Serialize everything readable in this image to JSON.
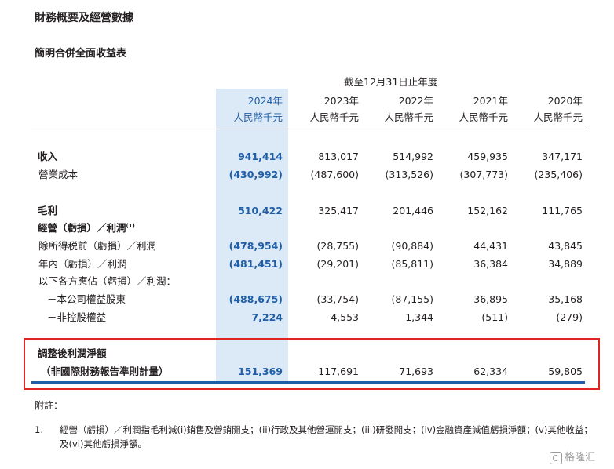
{
  "document": {
    "title": "財務概要及經營數據",
    "subtitle": "簡明合併全面收益表",
    "period_header": "截至12月31日止年度",
    "columns": [
      {
        "year": "2024年",
        "unit": "人民幣千元",
        "highlight": true
      },
      {
        "year": "2023年",
        "unit": "人民幣千元",
        "highlight": false
      },
      {
        "year": "2022年",
        "unit": "人民幣千元",
        "highlight": false
      },
      {
        "year": "2021年",
        "unit": "人民幣千元",
        "highlight": false
      },
      {
        "year": "2020年",
        "unit": "人民幣千元",
        "highlight": false
      }
    ],
    "rows": [
      {
        "label": "收入",
        "values": [
          "941,414",
          "813,017",
          "514,992",
          "459,935",
          "347,171"
        ]
      },
      {
        "label": "營業成本",
        "values": [
          "(430,992)",
          "(487,600)",
          "(313,526)",
          "(307,773)",
          "(235,406)"
        ]
      },
      {
        "label": "毛利",
        "values": [
          "510,422",
          "325,417",
          "201,446",
          "152,162",
          "111,765"
        ]
      },
      {
        "label": "經營（虧損）／利潤",
        "footnote": "(1)",
        "values": []
      },
      {
        "label": "除所得税前（虧損）／利潤",
        "values": [
          "(478,954)",
          "(28,755)",
          "(90,884)",
          "44,431",
          "43,845"
        ]
      },
      {
        "label": "年內（虧損）／利潤",
        "values": [
          "(481,451)",
          "(29,201)",
          "(85,811)",
          "36,384",
          "34,889"
        ]
      },
      {
        "label": "以下各方應佔（虧損）／利潤：",
        "values": []
      },
      {
        "label": "－本公司權益股東",
        "values": [
          "(488,675)",
          "(33,754)",
          "(87,155)",
          "36,895",
          "35,168"
        ]
      },
      {
        "label": "－非控股權益",
        "values": [
          "7,224",
          "4,553",
          "1,344",
          "(511)",
          "(279)"
        ]
      },
      {
        "label": "調整後利潤淨額",
        "values": []
      },
      {
        "label": "（非國際財務報告準則計量）",
        "values": [
          "151,369",
          "117,691",
          "71,693",
          "62,334",
          "59,805"
        ]
      }
    ],
    "notes_header": "附註：",
    "notes": [
      {
        "number": "1.",
        "text": "經營（虧損）／利潤指毛利減(i)銷售及營銷開支；(ii)行政及其他營運開支；(iii)研發開支；(iv)金融資產減值虧損淨額；(v)其他收益；及(vi)其他虧損淨額。"
      }
    ],
    "watermark": "格隆汇",
    "colors": {
      "highlight_bg": "#dce9f6",
      "highlight_text": "#1f5fa8",
      "annotation_box": "#e02424"
    }
  }
}
